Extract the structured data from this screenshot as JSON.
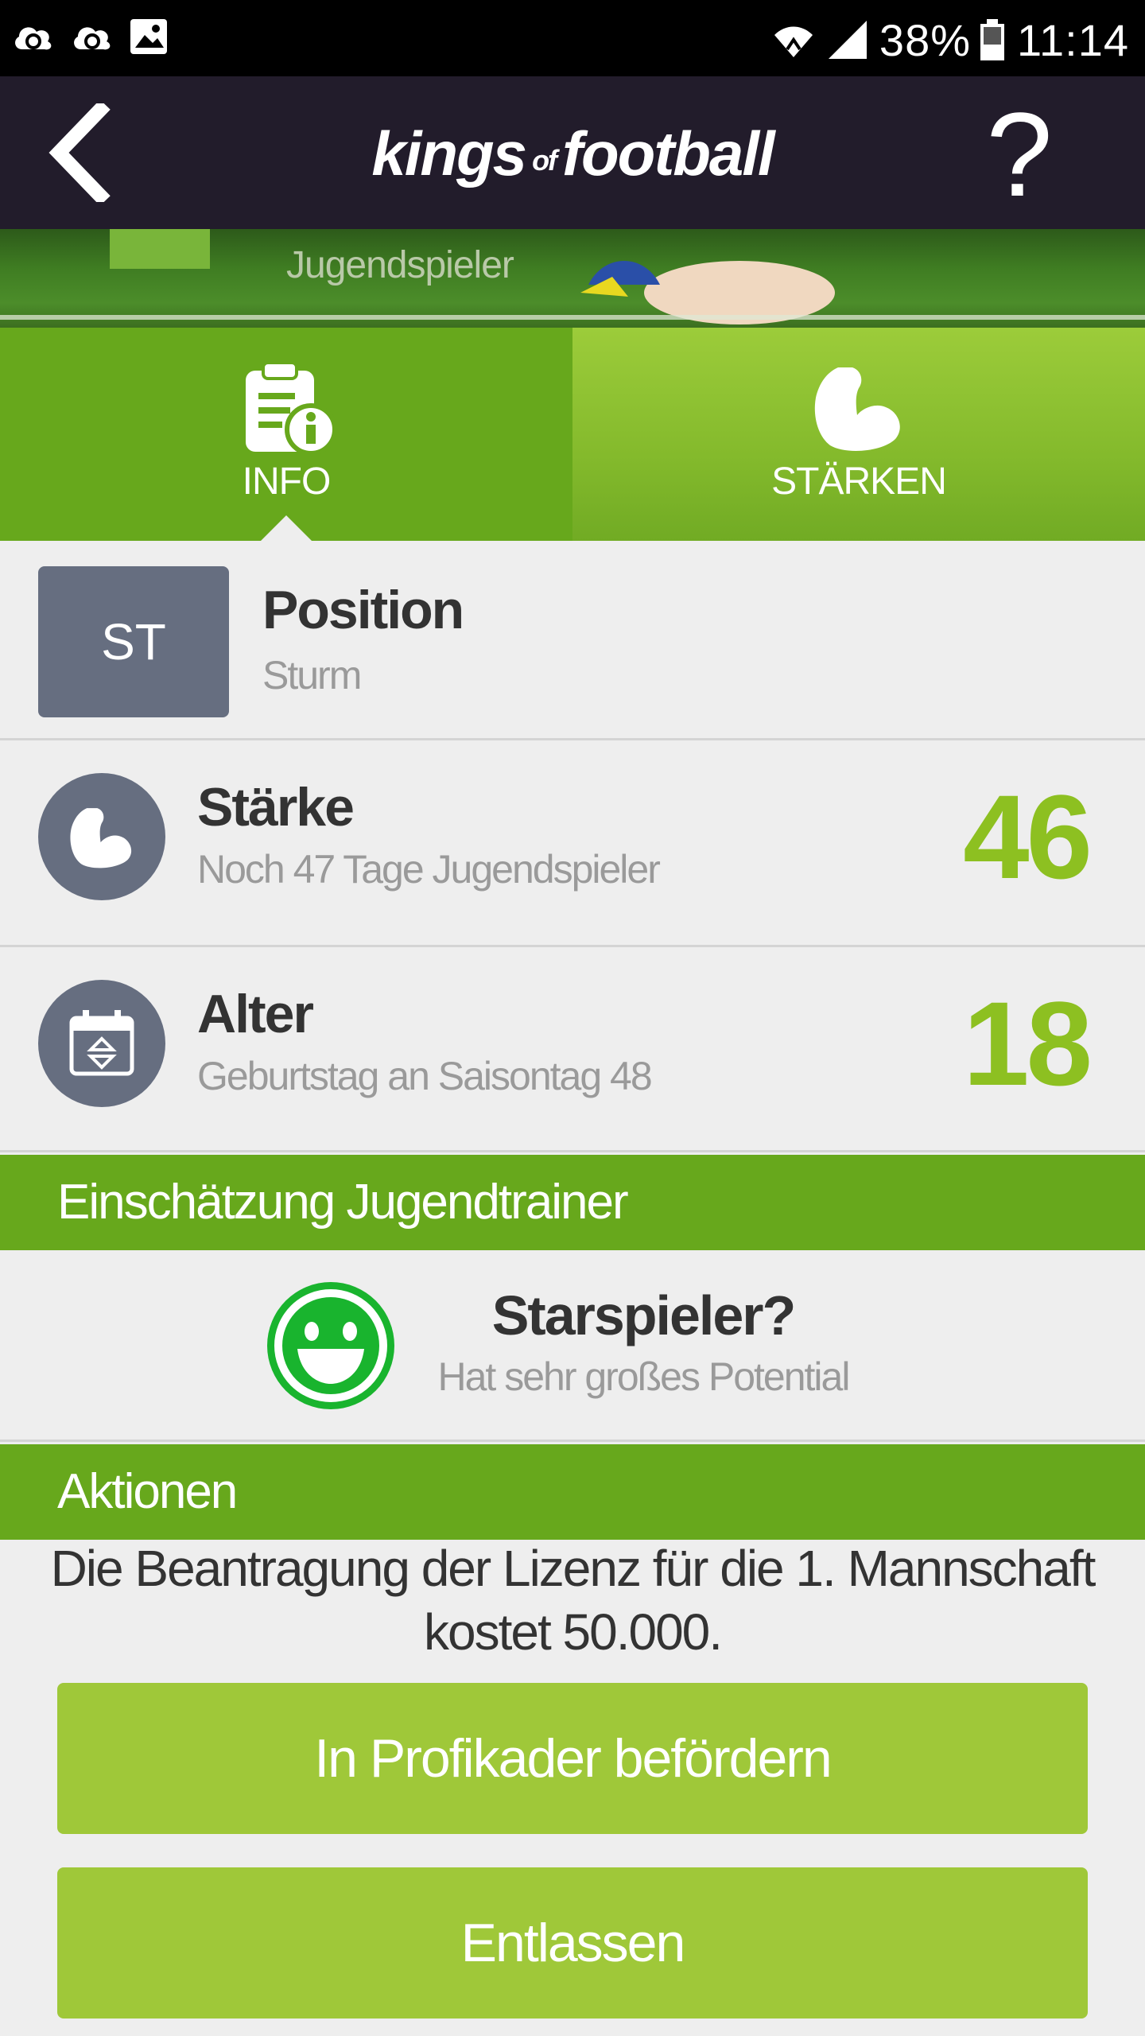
{
  "status_bar": {
    "battery": "38%",
    "time": "11:14"
  },
  "app_bar": {
    "brand_part1": "kings",
    "brand_part2": "of",
    "brand_part3": "football",
    "help_label": "?"
  },
  "banner": {
    "subtitle": "Jugendspieler"
  },
  "tabs": [
    {
      "label": "INFO"
    },
    {
      "label": "STÄRKEN"
    }
  ],
  "position": {
    "code": "ST",
    "title": "Position",
    "value": "Sturm"
  },
  "strength": {
    "title": "Stärke",
    "subtitle": "Noch 47 Tage Jugendspieler",
    "value": "46"
  },
  "age": {
    "title": "Alter",
    "subtitle": "Geburtstag an Saisontag 48",
    "value": "18"
  },
  "sections": {
    "assessment": "Einschätzung Jugendtrainer",
    "actions": "Aktionen"
  },
  "assessment": {
    "title": "Starspieler?",
    "subtitle": "Hat sehr großes Potential"
  },
  "actions": {
    "notice": "Die Beantragung der Lizenz für die 1. Mannschaft kostet 50.000.",
    "promote_button": "In Profikader befördern",
    "dismiss_button": "Entlassen"
  },
  "colors": {
    "app_bar": "#221c2b",
    "green_header": "#67a81c",
    "value_green": "#8dc021",
    "button_green": "#9fc839",
    "icon_gray": "#666e80",
    "smiley_green": "#19b42e"
  }
}
